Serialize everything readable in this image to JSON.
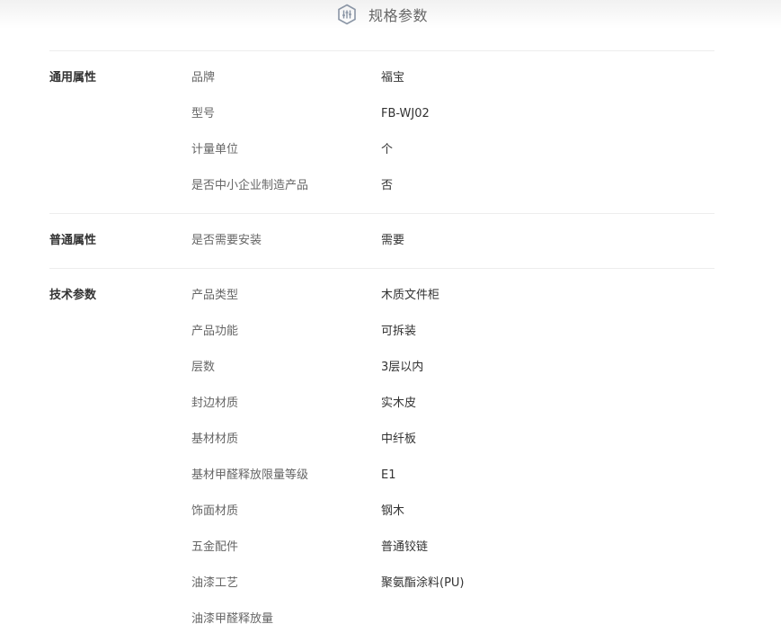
{
  "header": {
    "title": "规格参数",
    "icon": "settings-sliders-icon"
  },
  "sections": [
    {
      "title": "通用属性",
      "rows": [
        {
          "name": "品牌",
          "value": "福宝"
        },
        {
          "name": "型号",
          "value": "FB-WJ02"
        },
        {
          "name": "计量单位",
          "value": "个"
        },
        {
          "name": "是否中小企业制造产品",
          "value": "否"
        }
      ]
    },
    {
      "title": "普通属性",
      "rows": [
        {
          "name": "是否需要安装",
          "value": "需要"
        }
      ]
    },
    {
      "title": "技术参数",
      "rows": [
        {
          "name": "产品类型",
          "value": "木质文件柜"
        },
        {
          "name": "产品功能",
          "value": "可拆装"
        },
        {
          "name": "层数",
          "value": "3层以内"
        },
        {
          "name": "封边材质",
          "value": "实木皮"
        },
        {
          "name": "基材材质",
          "value": "中纤板"
        },
        {
          "name": "基材甲醛释放限量等级",
          "value": "E1"
        },
        {
          "name": "饰面材质",
          "value": "钢木"
        },
        {
          "name": "五金配件",
          "value": "普通铰链"
        },
        {
          "name": "油漆工艺",
          "value": "聚氨酯涂料(PU)"
        },
        {
          "name": "油漆甲醛释放量",
          "value": ""
        }
      ]
    }
  ],
  "colors": {
    "header_bg": "#f3f3f3",
    "divider": "#ededed",
    "label": "#666666",
    "value": "#333333",
    "icon": "#8a95a5"
  }
}
